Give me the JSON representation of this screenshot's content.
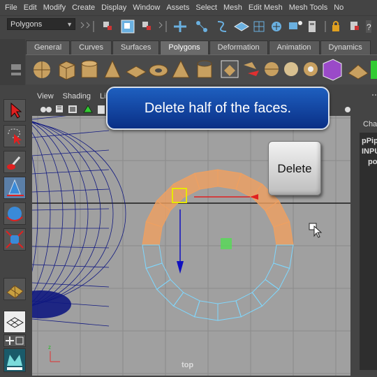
{
  "menu": [
    "File",
    "Edit",
    "Modify",
    "Create",
    "Display",
    "Window",
    "Assets",
    "Select",
    "Mesh",
    "Edit Mesh",
    "Mesh Tools",
    "No"
  ],
  "mode_select": "Polygons",
  "shelf_tabs": [
    "General",
    "Curves",
    "Surfaces",
    "Polygons",
    "Deformation",
    "Animation",
    "Dynamics"
  ],
  "shelf_active": "Polygons",
  "panel_menu": [
    "View",
    "Shading",
    "Li"
  ],
  "viewport_label": "top",
  "callout_text": "Delete half of the faces.",
  "key_label": "Delete",
  "channel_box": {
    "header": "Cha",
    "lines": [
      "pPip",
      "INPU",
      "po"
    ]
  },
  "colors": {
    "selected_faces": "#f0a060",
    "unselected_faces": "#7fd8ff",
    "wireframe": "#101880",
    "accent": "#1e5fbf"
  }
}
